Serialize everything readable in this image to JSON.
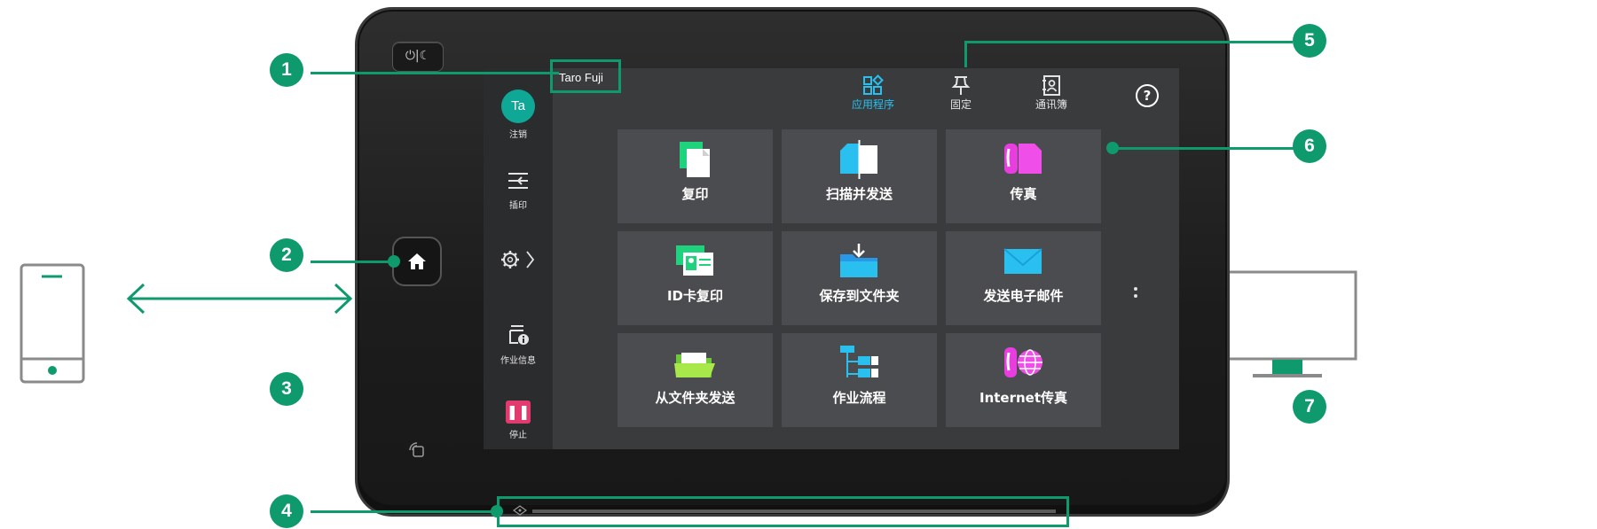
{
  "device": {
    "power_icon": "⏻|☾",
    "home_icon": "home-icon",
    "nfc_icon": "nfc-icon"
  },
  "header": {
    "user_name": "Taro Fuji",
    "tabs": [
      {
        "label": "应用程序",
        "icon": "apps-icon",
        "active": true
      },
      {
        "label": "固定",
        "icon": "pin-icon",
        "active": false
      },
      {
        "label": "通讯簿",
        "icon": "address-book-icon",
        "active": false
      }
    ],
    "help_symbol": "?"
  },
  "sidebar": {
    "avatar_initials": "Ta",
    "items": [
      {
        "label": "注销",
        "icon": "avatar"
      },
      {
        "label": "插印",
        "icon": "interrupt-icon"
      },
      {
        "label": "",
        "icon": "settings-icon"
      },
      {
        "label": "作业信息",
        "icon": "job-info-icon"
      },
      {
        "label": "停止",
        "icon": "stop-icon"
      }
    ]
  },
  "apps": [
    {
      "label": "复印",
      "icon": "copy-icon",
      "color": "#1fd37e"
    },
    {
      "label": "扫描并发送",
      "icon": "scan-send-icon",
      "color": "#29c0f0"
    },
    {
      "label": "传真",
      "icon": "fax-icon",
      "color": "#e83ee0"
    },
    {
      "label": "ID卡复印",
      "icon": "id-card-copy-icon",
      "color": "#1fd37e"
    },
    {
      "label": "保存到文件夹",
      "icon": "save-folder-icon",
      "color": "#29a8f0"
    },
    {
      "label": "发送电子邮件",
      "icon": "email-icon",
      "color": "#29c0f0"
    },
    {
      "label": "从文件夹发送",
      "icon": "send-from-folder-icon",
      "color": "#8fe04a"
    },
    {
      "label": "作业流程",
      "icon": "job-flow-icon",
      "color": "#29c0f0"
    },
    {
      "label": "Internet传真",
      "icon": "internet-fax-icon",
      "color": "#e83ee0"
    }
  ],
  "annotations": [
    "1",
    "2",
    "3",
    "4",
    "5",
    "6",
    "7"
  ],
  "colors": {
    "accent": "#0f9a6e",
    "screen_bg": "#3a3b3d",
    "tile_bg": "#4b4c4f",
    "active_tab": "#29c0f0",
    "avatar": "#0fa896",
    "stop": "#e23a6e"
  },
  "peripherals": {
    "phone_icon": "mobile-phone-icon",
    "monitor_icon": "monitor-icon"
  }
}
